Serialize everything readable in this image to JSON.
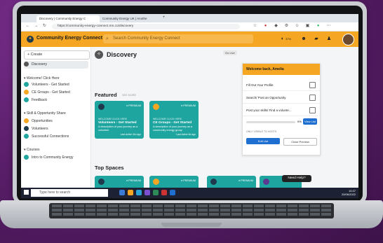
{
  "browser": {
    "tabs": [
      "Discovery | Community Energy C",
      "Community Energy UK | Anothe"
    ],
    "url": "https://community-energy-connect.mn.co/discovery"
  },
  "header": {
    "brand": "Community Energy Connect",
    "search_placeholder": "Search Community Energy Connect",
    "accent": "#f5a623",
    "progress_label": "37%"
  },
  "sidebar": {
    "create_label": "+ Create",
    "items": [
      {
        "label": "Discovery",
        "color": "#555555"
      },
      {
        "label": "Welcome! Click Here",
        "color": ""
      },
      {
        "label": "Volunteers - Get Started",
        "color": "#1fa59f"
      },
      {
        "label": "CE Groups - Get Started",
        "color": "#f5a623"
      },
      {
        "label": "Feedback",
        "color": "#1fa59f"
      },
      {
        "label": "Skill & Opportunity Share",
        "color": ""
      },
      {
        "label": "Opportunities",
        "color": "#f5a623"
      },
      {
        "label": "Volunteers",
        "color": "#1f3a4d"
      },
      {
        "label": "Successful Connections",
        "color": "#1fa59f"
      },
      {
        "label": "Courses",
        "color": ""
      },
      {
        "label": "Intro to Community Energy",
        "color": "#1fa59f"
      }
    ]
  },
  "main": {
    "title": "Discovery",
    "go_live": "Go Live",
    "featured_title": "Featured",
    "see_more": "SEE MORE",
    "featured_cards": [
      {
        "badge": "♦ PREMIUM",
        "kicker": "WELCOME! CLICK HERE",
        "title": "Volunteers - Get Started",
        "desc": "A description of your journey as a volunteer",
        "meta": "Last Active 11d ago"
      },
      {
        "badge": "♦ PREMIUM",
        "kicker": "WELCOME! CLICK HERE",
        "title": "CE Groups - Get Started",
        "desc": "A description of your journey as a community energy group",
        "meta": "Last Active 6d ago"
      }
    ],
    "top_spaces_title": "Top Spaces",
    "top_cards": [
      {
        "badge": "♦ PREMIUM",
        "kicker": "COURSES",
        "title": "Intro to Community Energy"
      },
      {
        "badge": "♦ PREMIUM",
        "kicker": "SKILL & OPPORTUNITY SHARE",
        "title": "Opportunities"
      },
      {
        "badge": "♦ PREMIUM",
        "kicker": "SKILL & OPPORTUNITY SHARE",
        "title": "Volunteers"
      },
      {
        "badge": "♦ PREMI",
        "kicker": "SKILL & OPPORTUNITY SHARE",
        "title": "Successful Conn"
      }
    ]
  },
  "panel": {
    "title": "Welcome back, Amelia",
    "tasks": [
      "Fill Out Your Profile",
      "Search/ Post an Opportunity",
      "Post your skills/ Find a volunte..."
    ],
    "progress": "0%",
    "view_list": "View List",
    "visible_note": "ONLY VISIBLE TO HOSTS",
    "edit_list": "Edit List",
    "close_preview": "Close Preview"
  },
  "help_label": "Need Help?",
  "taskbar": {
    "search_placeholder": "Type here to search",
    "time": "10:37",
    "date": "20/06/2022"
  }
}
